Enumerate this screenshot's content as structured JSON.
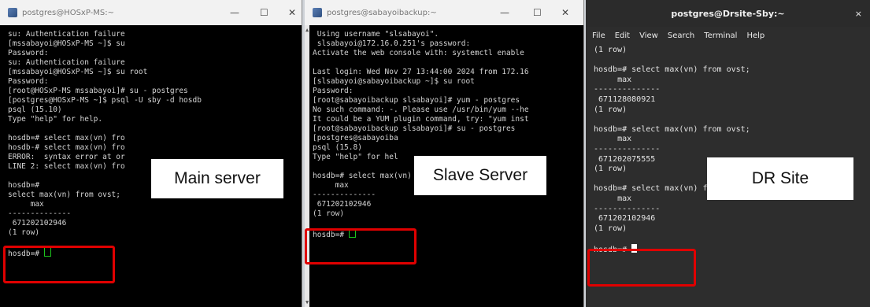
{
  "main": {
    "title": "postgres@HOSxP-MS:~",
    "lines": [
      "su: Authentication failure",
      "[mssabayoi@HOSxP-MS ~]$ su",
      "Password:",
      "su: Authentication failure",
      "[mssabayoi@HOSxP-MS ~]$ su root",
      "Password:",
      "[root@HOSxP-MS mssabayoi]# su - postgres",
      "[postgres@HOSxP-MS ~]$ psql -U sby -d hosdb",
      "psql (15.10)",
      "Type \"help\" for help.",
      "",
      "hosdb=# select max(vn) fro",
      "hosdb-# select max(vn) fro",
      "ERROR:  syntax error at or",
      "LINE 2: select max(vn) fro",
      "",
      "hosdb=#",
      "select max(vn) from ovst;",
      "     max",
      "--------------",
      " 671202102946",
      "(1 row)",
      "",
      "hosdb=# "
    ],
    "label": "Main server",
    "controls": {
      "min": "—",
      "max": "☐",
      "close": "✕"
    }
  },
  "slave": {
    "title": "postgres@sabayoibackup:~",
    "lines": [
      " Using username \"slsabayoi\".",
      " slsabayoi@172.16.0.251's password:",
      "Activate the web console with: systemctl enable",
      "",
      "Last login: Wed Nov 27 13:44:00 2024 from 172.16",
      "[slsabayoi@sabayoibackup ~]$ su root",
      "Password:",
      "[root@sabayoibackup slsabayoi]# yum - postgres",
      "No such command: -. Please use /usr/bin/yum --he",
      "It could be a YUM plugin command, try: \"yum inst",
      "[root@sabayoibackup slsabayoi]# su - postgres",
      "[postgres@sabayoiba",
      "psql (15.8)",
      "Type \"help\" for hel",
      "",
      "hosdb=# select max(vn) from ovst;",
      "     max",
      "--------------",
      " 671202102946",
      "(1 row)",
      "",
      "hosdb=# "
    ],
    "label": "Slave Server",
    "controls": {
      "min": "—",
      "max": "☐",
      "close": "✕"
    }
  },
  "dr": {
    "title": "postgres@Drsite-Sby:~",
    "menu": [
      "File",
      "Edit",
      "View",
      "Search",
      "Terminal",
      "Help"
    ],
    "lines": [
      "(1 row)",
      "",
      "hosdb=# select max(vn) from ovst;",
      "     max",
      "--------------",
      " 671128080921",
      "(1 row)",
      "",
      "hosdb=# select max(vn) from ovst;",
      "     max",
      "--------------",
      " 671202075555",
      "(1 row)",
      "",
      "hosdb=# select max(vn) from ovst;",
      "     max",
      "--------------",
      " 671202102946",
      "(1 row)",
      "",
      "hosdb=# "
    ],
    "label": "DR Site",
    "controls": {
      "close": "×"
    }
  },
  "colors": {
    "highlight": "#e00000",
    "cursor": "#1dc51d"
  }
}
